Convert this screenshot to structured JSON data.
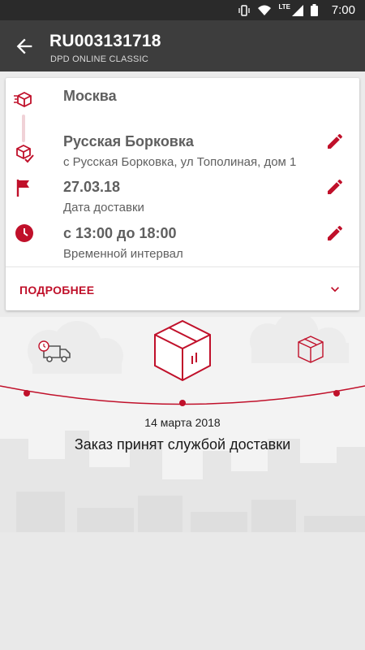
{
  "status_bar": {
    "time": "7:00",
    "network": "LTE"
  },
  "header": {
    "title": "RU003131718",
    "subtitle": "DPD ONLINE CLASSIC"
  },
  "details": {
    "origin": {
      "city": "Москва"
    },
    "destination": {
      "city": "Русская Борковка",
      "address": "с Русская Борковка, ул Тополиная, дом 1"
    },
    "delivery_date": {
      "value": "27.03.18",
      "label": "Дата доставки"
    },
    "time_interval": {
      "value": "с 13:00 до 18:00",
      "label": "Временной интервал"
    },
    "more_label": "ПОДРОБНЕЕ"
  },
  "tracking": {
    "date": "14 марта 2018",
    "status": "Заказ принят службой доставки",
    "progress_stage": 2,
    "progress_stages_total": 3
  },
  "colors": {
    "accent": "#c0102a",
    "appbar": "#3d3d3d",
    "statusbar": "#2a2a2a"
  }
}
